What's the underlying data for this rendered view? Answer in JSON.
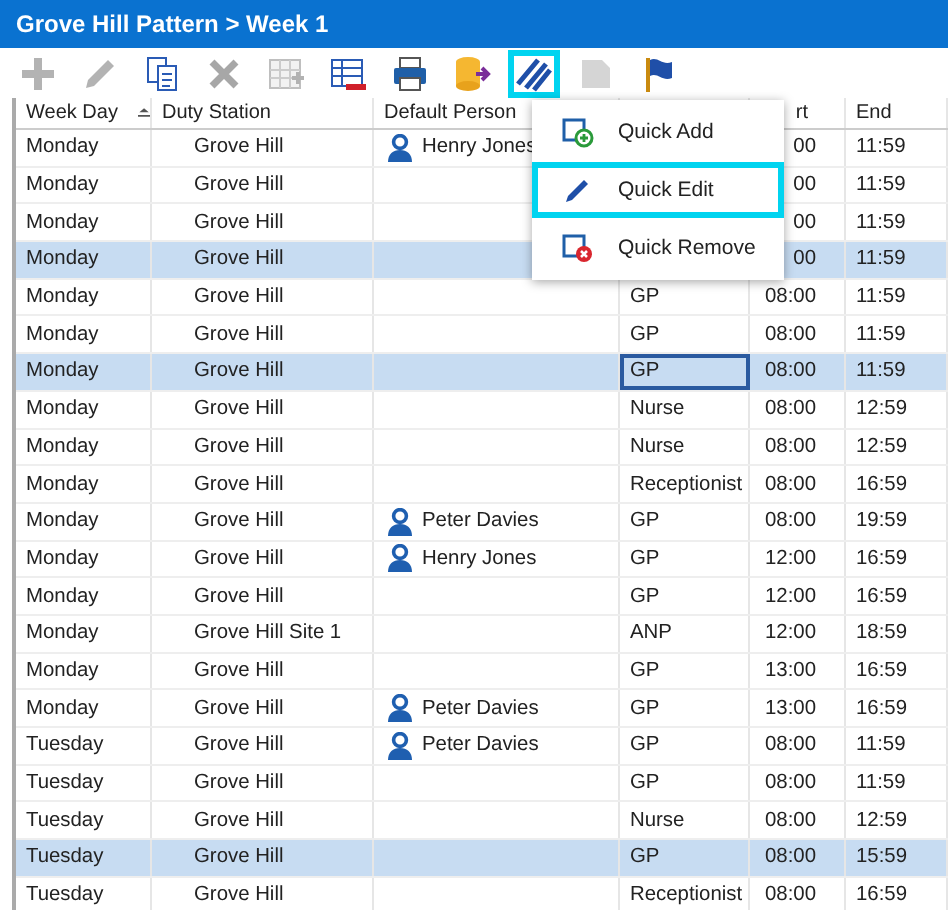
{
  "window": {
    "title": "Grove Hill Pattern > Week 1"
  },
  "toolbar": [
    {
      "kind": "add",
      "disabled": true,
      "highlighted": false
    },
    {
      "kind": "edit",
      "disabled": true,
      "highlighted": false
    },
    {
      "kind": "copy",
      "disabled": false,
      "highlighted": false
    },
    {
      "kind": "delete",
      "disabled": true,
      "highlighted": false
    },
    {
      "kind": "add-row",
      "disabled": true,
      "highlighted": false
    },
    {
      "kind": "remove-row",
      "disabled": false,
      "highlighted": false
    },
    {
      "kind": "print",
      "disabled": false,
      "highlighted": false
    },
    {
      "kind": "export",
      "disabled": false,
      "highlighted": false
    },
    {
      "kind": "quick",
      "disabled": false,
      "highlighted": true
    },
    {
      "kind": "document",
      "disabled": true,
      "highlighted": false
    },
    {
      "kind": "flag",
      "disabled": false,
      "highlighted": false
    }
  ],
  "table": {
    "columns": [
      {
        "label": "Week Day",
        "sorted": true
      },
      {
        "label": "Duty Station",
        "sorted": false
      },
      {
        "label": "Default Person",
        "sorted": false
      },
      {
        "label": "rt",
        "sorted": false
      },
      {
        "label": "End",
        "sorted": false
      }
    ],
    "rows": [
      {
        "day": "Monday",
        "station": "Grove Hill",
        "person": "Henry Jones",
        "start": "00",
        "end": "11:59",
        "selected": false
      },
      {
        "day": "Monday",
        "station": "Grove Hill",
        "start": "00",
        "end": "11:59",
        "selected": false
      },
      {
        "day": "Monday",
        "station": "Grove Hill",
        "start": "00",
        "end": "11:59",
        "selected": false
      },
      {
        "day": "Monday",
        "station": "Grove Hill",
        "start": "00",
        "end": "11:59",
        "selected": true
      },
      {
        "day": "Monday",
        "station": "Grove Hill",
        "role": "GP",
        "start": "08:00",
        "end": "11:59",
        "selected": false,
        "focused": false
      },
      {
        "day": "Monday",
        "station": "Grove Hill",
        "role": "GP",
        "start": "08:00",
        "end": "11:59",
        "selected": false,
        "focused": false
      },
      {
        "day": "Monday",
        "station": "Grove Hill",
        "role": "GP",
        "start": "08:00",
        "end": "11:59",
        "selected": true,
        "focused": true
      },
      {
        "day": "Monday",
        "station": "Grove Hill",
        "role": "Nurse",
        "start": "08:00",
        "end": "12:59",
        "selected": false,
        "focused": false
      },
      {
        "day": "Monday",
        "station": "Grove Hill",
        "role": "Nurse",
        "start": "08:00",
        "end": "12:59",
        "selected": false,
        "focused": false
      },
      {
        "day": "Monday",
        "station": "Grove Hill",
        "role": "Receptionist",
        "start": "08:00",
        "end": "16:59",
        "selected": false,
        "focused": false
      },
      {
        "day": "Monday",
        "station": "Grove Hill",
        "person": "Peter Davies",
        "role": "GP",
        "start": "08:00",
        "end": "19:59",
        "selected": false,
        "focused": false
      },
      {
        "day": "Monday",
        "station": "Grove Hill",
        "person": "Henry Jones",
        "role": "GP",
        "start": "12:00",
        "end": "16:59",
        "selected": false,
        "focused": false
      },
      {
        "day": "Monday",
        "station": "Grove Hill",
        "role": "GP",
        "start": "12:00",
        "end": "16:59",
        "selected": false,
        "focused": false
      },
      {
        "day": "Monday",
        "station": "Grove Hill Site 1",
        "role": "ANP",
        "start": "12:00",
        "end": "18:59",
        "selected": false,
        "focused": false
      },
      {
        "day": "Monday",
        "station": "Grove Hill",
        "role": "GP",
        "start": "13:00",
        "end": "16:59",
        "selected": false,
        "focused": false
      },
      {
        "day": "Monday",
        "station": "Grove Hill",
        "person": "Peter Davies",
        "role": "GP",
        "start": "13:00",
        "end": "16:59",
        "selected": false,
        "focused": false
      },
      {
        "day": "Tuesday",
        "station": "Grove Hill",
        "person": "Peter Davies",
        "role": "GP",
        "start": "08:00",
        "end": "11:59",
        "selected": false,
        "focused": false
      },
      {
        "day": "Tuesday",
        "station": "Grove Hill",
        "role": "GP",
        "start": "08:00",
        "end": "11:59",
        "selected": false,
        "focused": false
      },
      {
        "day": "Tuesday",
        "station": "Grove Hill",
        "role": "Nurse",
        "start": "08:00",
        "end": "12:59",
        "selected": false,
        "focused": false
      },
      {
        "day": "Tuesday",
        "station": "Grove Hill",
        "role": "GP",
        "start": "08:00",
        "end": "15:59",
        "selected": true,
        "focused": false
      },
      {
        "day": "Tuesday",
        "station": "Grove Hill",
        "role": "Receptionist",
        "start": "08:00",
        "end": "16:59",
        "selected": false,
        "focused": false
      }
    ]
  },
  "menu": {
    "items": [
      {
        "label": "Quick Add",
        "kind": "add",
        "highlighted": false
      },
      {
        "label": "Quick Edit",
        "kind": "edit",
        "highlighted": true
      },
      {
        "label": "Quick Remove",
        "kind": "remove",
        "highlighted": false
      }
    ]
  }
}
